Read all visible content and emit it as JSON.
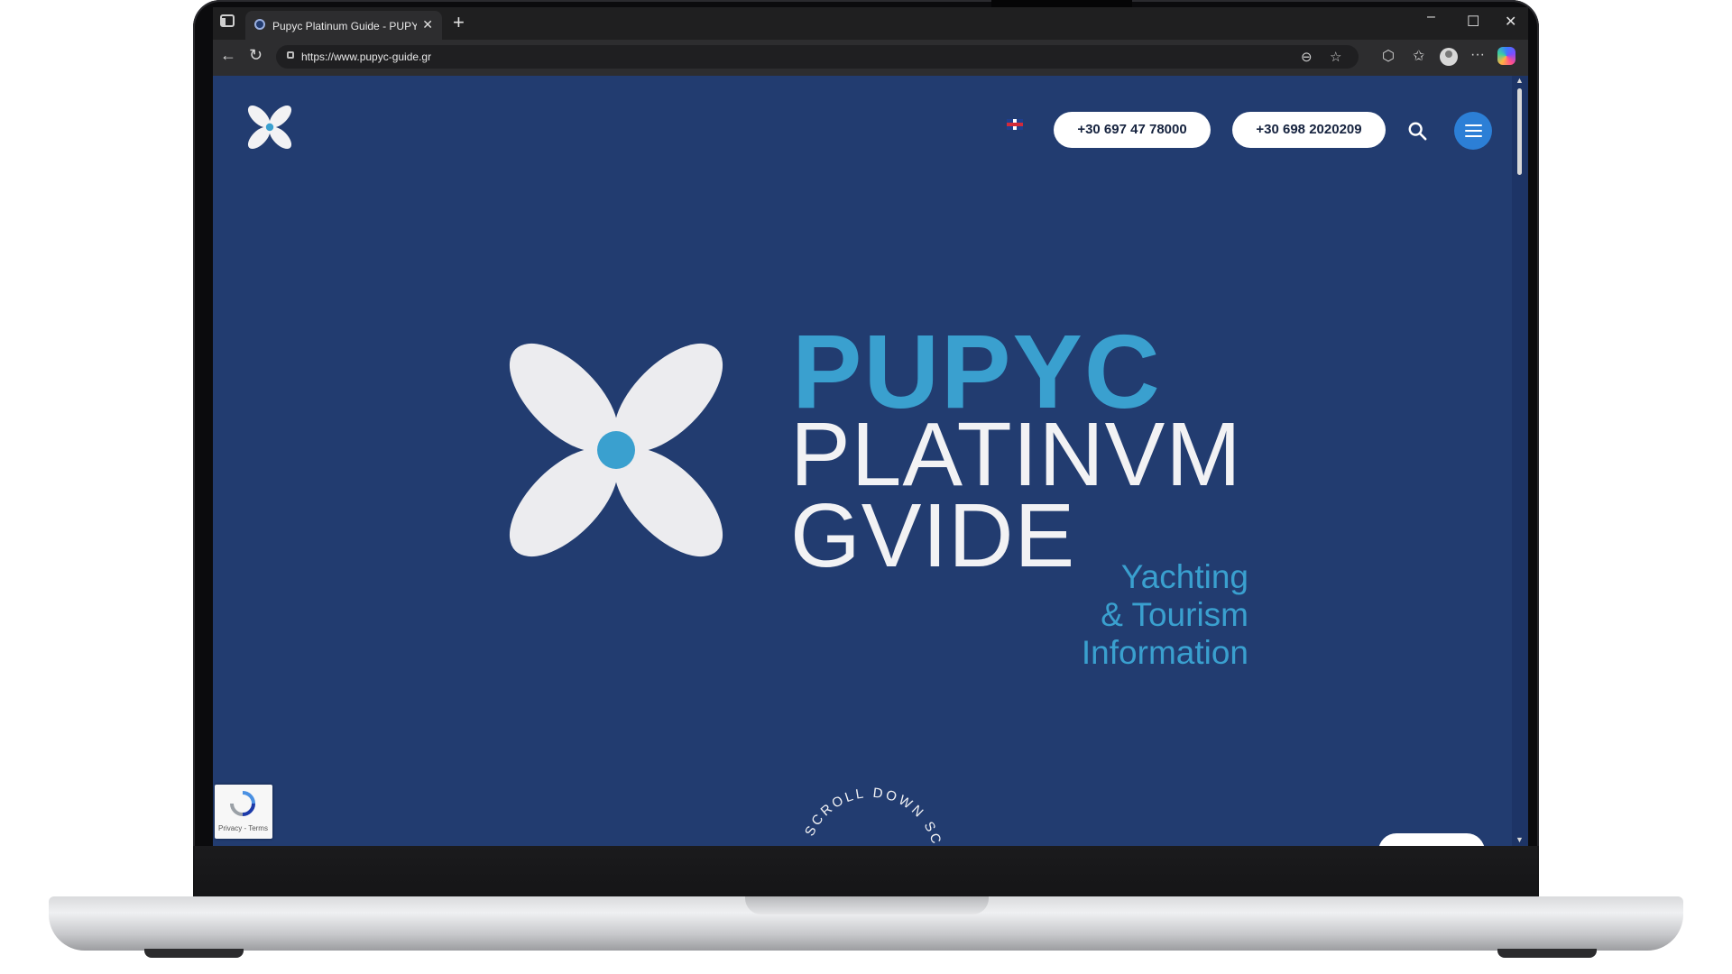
{
  "browser": {
    "tab_title": "Pupyc Platinum Guide - PUPYC Pl",
    "new_tab_icon": "+",
    "address_url": "https://www.pupyc-guide.gr"
  },
  "site": {
    "language_icon": "uk-flag-icon",
    "phone_1": "+30 697 47 78000",
    "phone_2": "+30 698 2020209"
  },
  "hero": {
    "title_line_1": "PUPYC",
    "title_line_2": "PLATINVM",
    "title_line_3": "GVIDE",
    "tagline_1": "Yachting",
    "tagline_2": "& Tourism",
    "tagline_3": "Information",
    "scroll_text": "SCROLL DOWN SCROLL DOWN"
  },
  "recaptcha": {
    "label": "Privacy - Terms"
  },
  "colors": {
    "page_bg": "#223c70",
    "accent_blue": "#3aa0cf",
    "menu_button": "#2c7fd6"
  }
}
